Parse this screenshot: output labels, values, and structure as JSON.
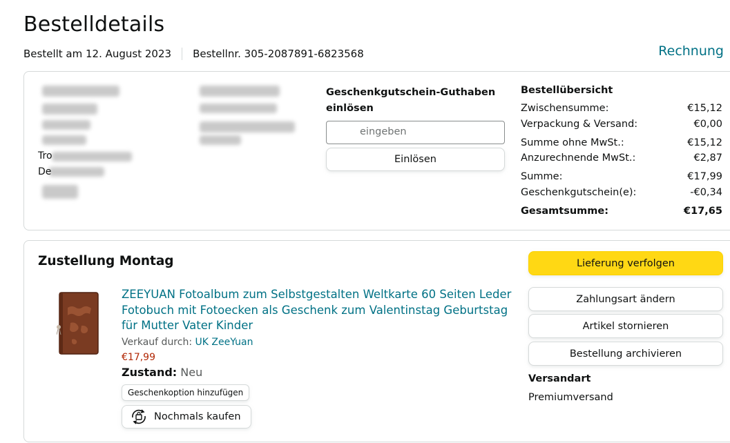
{
  "header": {
    "title": "Bestelldetails",
    "ordered_on": "Bestellt am 12. August 2023",
    "order_number": "Bestellnr. 305-2087891-6823568",
    "invoice_link": "Rechnung"
  },
  "address": {
    "visible_fragments": [
      "Tro",
      "De"
    ]
  },
  "gift_card": {
    "title": "Geschenkgutschein-Guthaben einlösen",
    "input_placeholder": "eingeben",
    "redeem_label": "Einlösen"
  },
  "order_summary": {
    "title": "Bestellübersicht",
    "rows": [
      {
        "label": "Zwischensumme:",
        "value": "€15,12"
      },
      {
        "label": "Verpackung & Versand:",
        "value": "€0,00"
      },
      {
        "label": "Summe ohne MwSt.:",
        "value": "€15,12"
      },
      {
        "label": "Anzurechnende MwSt.:",
        "value": "€2,87"
      },
      {
        "label": "Summe:",
        "value": "€17,99"
      },
      {
        "label": "Geschenkgutschein(e):",
        "value": "-€0,34"
      },
      {
        "label": "Gesamtsumme:",
        "value": "€17,65"
      }
    ]
  },
  "delivery": {
    "title": "Zustellung Montag",
    "product": {
      "title": "ZEEYUAN Fotoalbum zum Selbstgestalten Weltkarte 60 Seiten Leder Fotobuch mit Fotoecken als Geschenk zum Valentinstag Geburtstag für Mutter Vater Kinder",
      "sold_by_label": "Verkauf durch:",
      "seller": "UK ZeeYuan",
      "price": "€17,99",
      "condition_label": "Zustand:",
      "condition_value": "Neu",
      "gift_option_label": "Geschenkoption hinzufügen",
      "buy_again_label": "Nochmals kaufen"
    },
    "actions": {
      "track": "Lieferung verfolgen",
      "change_payment": "Zahlungsart ändern",
      "cancel_items": "Artikel stornieren",
      "archive": "Bestellung archivieren"
    },
    "shipping_label": "Versandart",
    "shipping_value": "Premiumversand"
  },
  "colors": {
    "link": "#007185",
    "price": "#b12704",
    "primary_button": "#ffd814",
    "border": "#d5d9d9"
  },
  "icons": {
    "buy_again": "reorder-bag-icon"
  }
}
